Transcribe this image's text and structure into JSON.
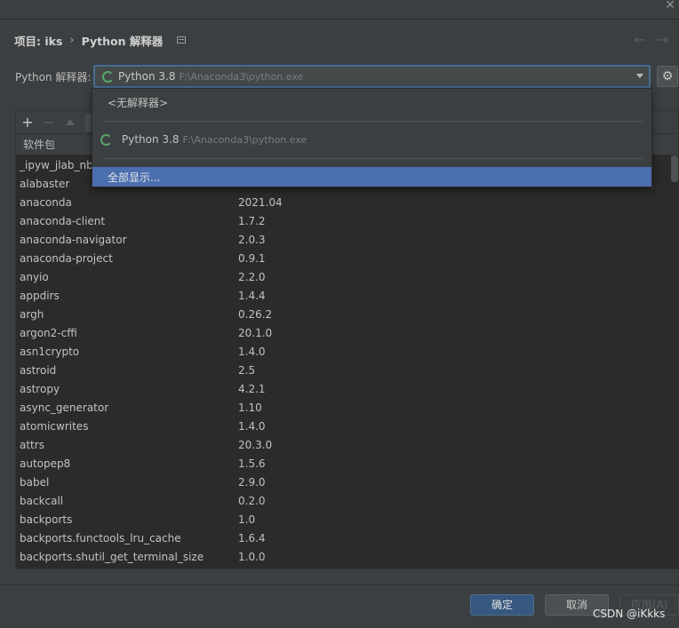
{
  "breadcrumb": {
    "project": "项目: iks",
    "separator": "›",
    "page": "Python 解释器"
  },
  "interpreter": {
    "label": "Python 解释器:",
    "selected_name": "Python 3.8",
    "selected_path": "F:\\Anaconda3\\python.exe"
  },
  "dropdown": {
    "no_interpreter": "<无解释器>",
    "option_name": "Python 3.8",
    "option_path": "F:\\Anaconda3\\python.exe",
    "show_all": "全部显示..."
  },
  "toolbar": {
    "add": "+",
    "remove": "−"
  },
  "table": {
    "header_package": "软件包",
    "rows": [
      {
        "name": "_ipyw_jlab_nb_ext_conf",
        "version": ""
      },
      {
        "name": "alabaster",
        "version": ""
      },
      {
        "name": "anaconda",
        "version": "2021.04"
      },
      {
        "name": "anaconda-client",
        "version": "1.7.2"
      },
      {
        "name": "anaconda-navigator",
        "version": "2.0.3"
      },
      {
        "name": "anaconda-project",
        "version": "0.9.1"
      },
      {
        "name": "anyio",
        "version": "2.2.0"
      },
      {
        "name": "appdirs",
        "version": "1.4.4"
      },
      {
        "name": "argh",
        "version": "0.26.2"
      },
      {
        "name": "argon2-cffi",
        "version": "20.1.0"
      },
      {
        "name": "asn1crypto",
        "version": "1.4.0"
      },
      {
        "name": "astroid",
        "version": "2.5"
      },
      {
        "name": "astropy",
        "version": "4.2.1"
      },
      {
        "name": "async_generator",
        "version": "1.10"
      },
      {
        "name": "atomicwrites",
        "version": "1.4.0"
      },
      {
        "name": "attrs",
        "version": "20.3.0"
      },
      {
        "name": "autopep8",
        "version": "1.5.6"
      },
      {
        "name": "babel",
        "version": "2.9.0"
      },
      {
        "name": "backcall",
        "version": "0.2.0"
      },
      {
        "name": "backports",
        "version": "1.0"
      },
      {
        "name": "backports.functools_lru_cache",
        "version": "1.6.4"
      },
      {
        "name": "backports.shutil_get_terminal_size",
        "version": "1.0.0"
      }
    ]
  },
  "buttons": {
    "ok": "确定",
    "cancel": "取消",
    "apply": "应用(A)"
  },
  "watermark": "CSDN @iKkks"
}
